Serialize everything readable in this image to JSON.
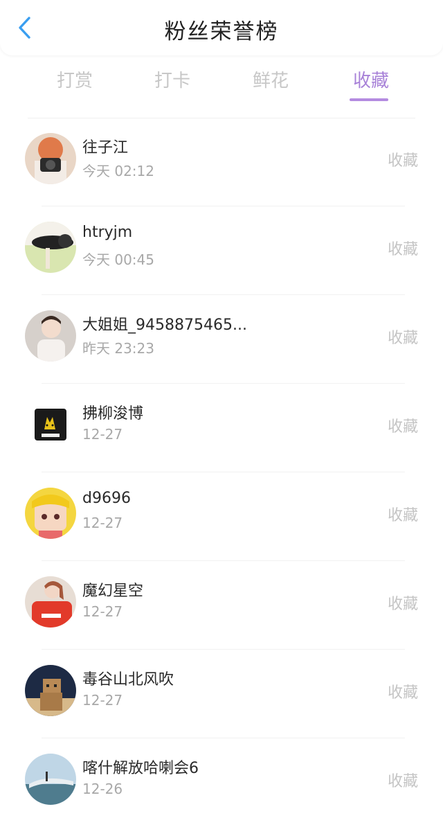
{
  "header": {
    "title": "粉丝荣誉榜"
  },
  "tabs": [
    {
      "label": "打赏"
    },
    {
      "label": "打卡"
    },
    {
      "label": "鲜花"
    },
    {
      "label": "收藏",
      "active": true
    }
  ],
  "colors": {
    "accent": "#a882d8",
    "back": "#3a9ef0"
  },
  "fans": [
    {
      "name": "往子江",
      "time": "今天 02:12",
      "action": "收藏"
    },
    {
      "name": "htryjm",
      "time": "今天 00:45",
      "action": "收藏"
    },
    {
      "name": "大姐姐_9458875465...",
      "time": "昨天 23:23",
      "action": "收藏"
    },
    {
      "name": "拂柳浚博",
      "time": "12-27",
      "action": "收藏"
    },
    {
      "name": "d9696",
      "time": "12-27",
      "action": "收藏"
    },
    {
      "name": "魔幻星空",
      "time": "12-27",
      "action": "收藏"
    },
    {
      "name": "毒谷山北风吹",
      "time": "12-27",
      "action": "收藏"
    },
    {
      "name": "喀什解放哈喇会6",
      "time": "12-26",
      "action": "收藏"
    }
  ]
}
